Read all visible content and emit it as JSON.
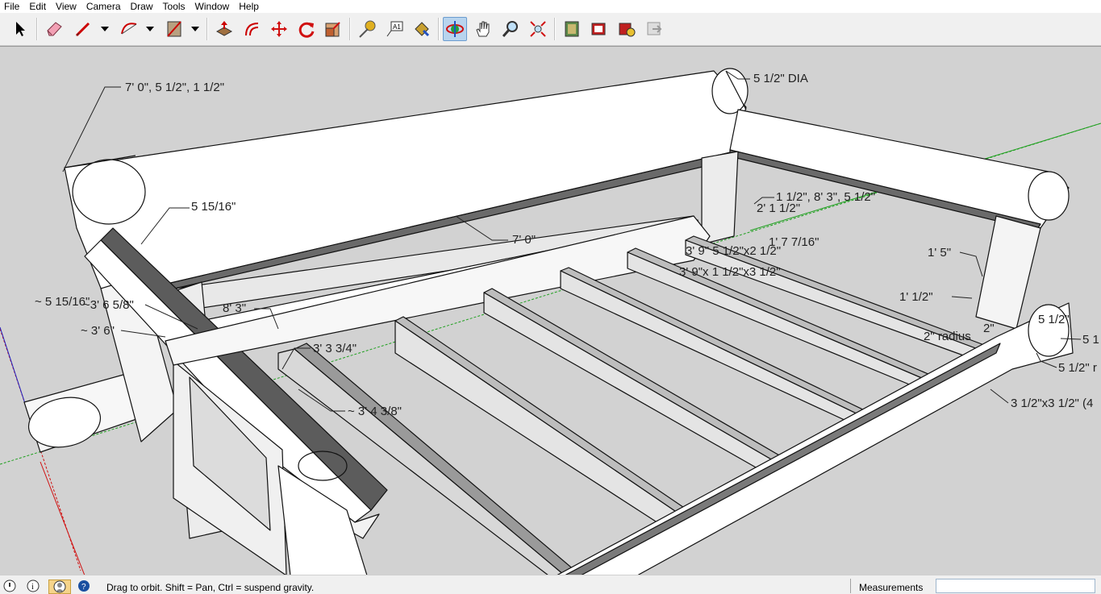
{
  "menu": [
    "File",
    "Edit",
    "View",
    "Camera",
    "Draw",
    "Tools",
    "Window",
    "Help"
  ],
  "toolbar": {
    "tools": [
      {
        "name": "select-tool-icon"
      },
      {
        "name": "eraser-tool-icon"
      },
      {
        "name": "line-tool-icon"
      },
      {
        "name": "arc-tool-icon"
      },
      {
        "name": "rectangle-tool-icon"
      },
      {
        "name": "push-pull-tool-icon"
      },
      {
        "name": "offset-tool-icon"
      },
      {
        "name": "move-tool-icon"
      },
      {
        "name": "rotate-tool-icon"
      },
      {
        "name": "scale-tool-icon"
      },
      {
        "name": "tape-measure-tool-icon"
      },
      {
        "name": "text-tool-icon"
      },
      {
        "name": "paint-bucket-tool-icon"
      },
      {
        "name": "orbit-tool-icon",
        "active": true
      },
      {
        "name": "pan-tool-icon"
      },
      {
        "name": "zoom-tool-icon"
      },
      {
        "name": "zoom-extents-tool-icon"
      },
      {
        "name": "warehouse-icon"
      },
      {
        "name": "extension-warehouse-icon"
      },
      {
        "name": "extension-manager-icon"
      },
      {
        "name": "send-to-layout-icon"
      }
    ]
  },
  "dimensions": [
    "7' 0\", 5 1/2\", 1 1/2\"",
    "5 1/2\" DIA",
    "5 15/16\"",
    "7' 0\"",
    "1 1/2\", 8' 3\", 5 1/2\"",
    "2' 1 1/2\"",
    "1' 7 7/16\"",
    "3' 9\" 5 1/2\"x2 1/2\"",
    "3' 9\"x 1 1/2\"x3 1/2\"",
    "1' 5\"",
    "~ 5 15/16\"",
    "~3' 6 5/8\"",
    "8' 3\"",
    "~ 3' 6\"",
    "1' 1/2\"",
    "5 1/2\"",
    "2\" radius",
    "2\"",
    "5 1",
    "3' 3 3/4\"",
    "5 1/2\" r",
    "~ 3' 4 3/8\"",
    "3 1/2\"x3 1/2\" (4"
  ],
  "status": {
    "message": "Drag to orbit. Shift = Pan, Ctrl = suspend gravity.",
    "measurements_label": "Measurements",
    "measurements_value": ""
  },
  "colors": {
    "background": "#d2d2d2",
    "face_light": "#ffffff",
    "face_mid": "#e6e6e6",
    "face_dark": "#5c5c5c",
    "edge": "#111111",
    "axis_red": "#d01010",
    "axis_green": "#10a010",
    "axis_blue": "#1010c0"
  }
}
